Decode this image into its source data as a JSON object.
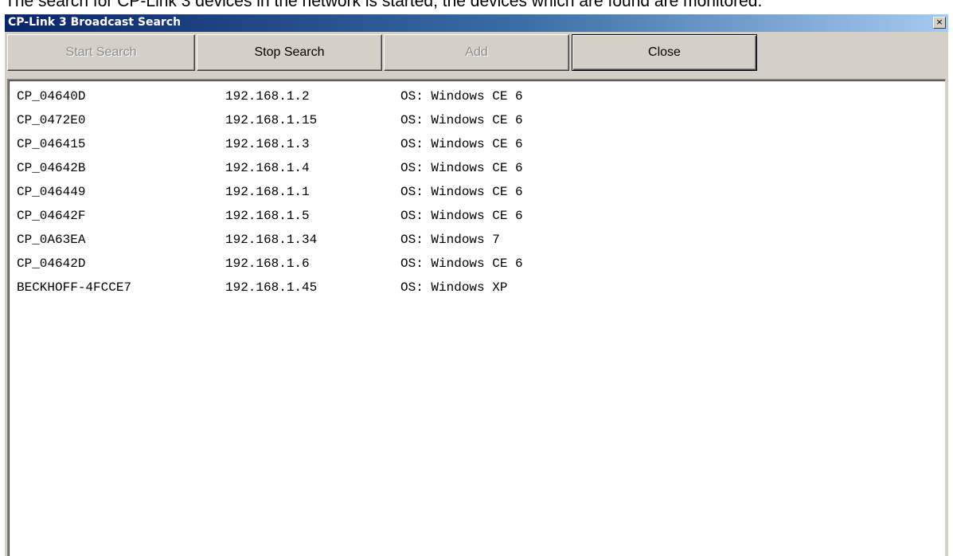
{
  "page_caption": "The search for CP-Link 3 devices in the network is started; the devices which are found are monitored.",
  "window": {
    "title": "CP-Link 3 Broadcast Search",
    "close_glyph": "×"
  },
  "toolbar": {
    "start_label": "Start Search",
    "stop_label": "Stop Search",
    "add_label": "Add",
    "close_label": "Close"
  },
  "devices": [
    {
      "name": "CP_04640D",
      "ip": "192.168.1.2",
      "os": "OS: Windows CE 6"
    },
    {
      "name": "CP_0472E0",
      "ip": "192.168.1.15",
      "os": "OS: Windows CE 6"
    },
    {
      "name": "CP_046415",
      "ip": "192.168.1.3",
      "os": "OS: Windows CE 6"
    },
    {
      "name": "CP_04642B",
      "ip": "192.168.1.4",
      "os": "OS: Windows CE 6"
    },
    {
      "name": "CP_046449",
      "ip": "192.168.1.1",
      "os": "OS: Windows CE 6"
    },
    {
      "name": "CP_04642F",
      "ip": "192.168.1.5",
      "os": "OS: Windows CE 6"
    },
    {
      "name": "CP_0A63EA",
      "ip": "192.168.1.34",
      "os": "OS: Windows 7"
    },
    {
      "name": "CP_04642D",
      "ip": "192.168.1.6",
      "os": "OS: Windows CE 6"
    },
    {
      "name": "BECKHOFF-4FCCE7",
      "ip": "192.168.1.45",
      "os": "OS: Windows XP"
    }
  ]
}
